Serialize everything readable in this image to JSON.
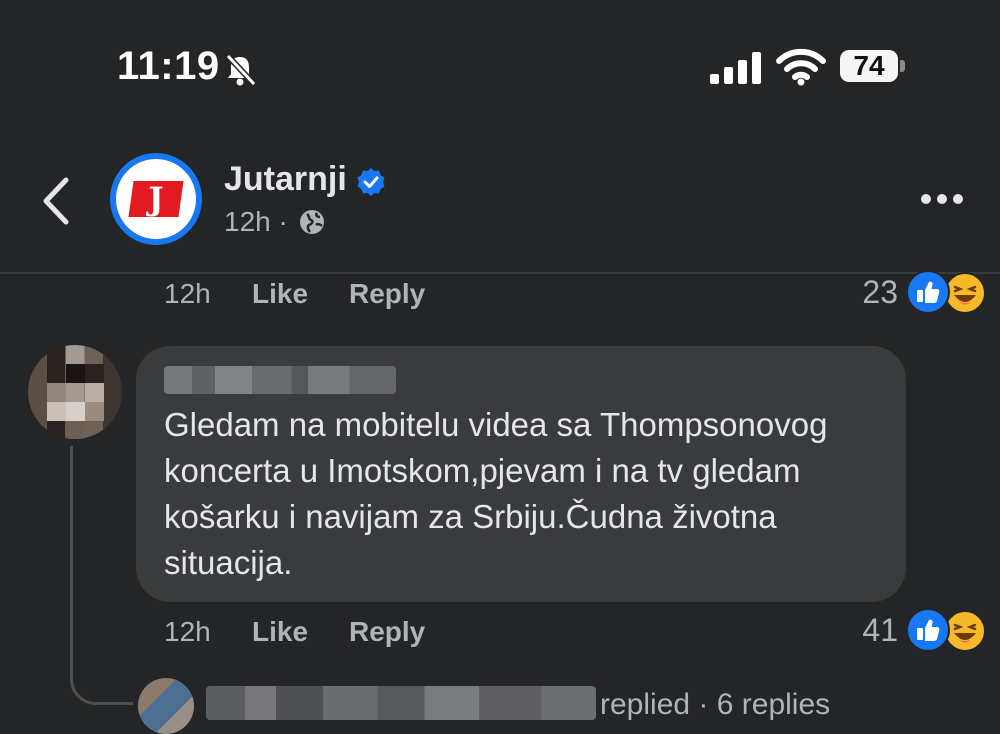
{
  "status_bar": {
    "time": "11:19",
    "battery": "74",
    "icons": [
      "bell-slash-icon",
      "signal-icon",
      "wifi-icon",
      "battery-icon"
    ]
  },
  "header": {
    "page_name": "Jutarnji",
    "avatar_letter": "J",
    "time_ago": "12h",
    "separator": "·",
    "icons": [
      "back-icon",
      "verified-badge-icon",
      "globe-icon",
      "more-icon"
    ]
  },
  "top_actions": {
    "time": "12h",
    "like": "Like",
    "reply": "Reply",
    "reactions_count": "23"
  },
  "comment": {
    "text": "Gledam na mobitelu videa sa Thompsonovog koncerta u Imotskom,pjevam i na tv gledam košarku i navijam za Srbiju.Čudna životna situacija.",
    "time": "12h",
    "like": "Like",
    "reply": "Reply",
    "reactions_count": "41"
  },
  "replies_summary": {
    "replied": "replied",
    "separator": "·",
    "count": "6 replies"
  },
  "colors": {
    "background": "#242526",
    "bubble": "#3a3b3c",
    "like_blue": "#1877f2",
    "haha_yellow": "#f7b928",
    "brand_red": "#e21b23"
  }
}
